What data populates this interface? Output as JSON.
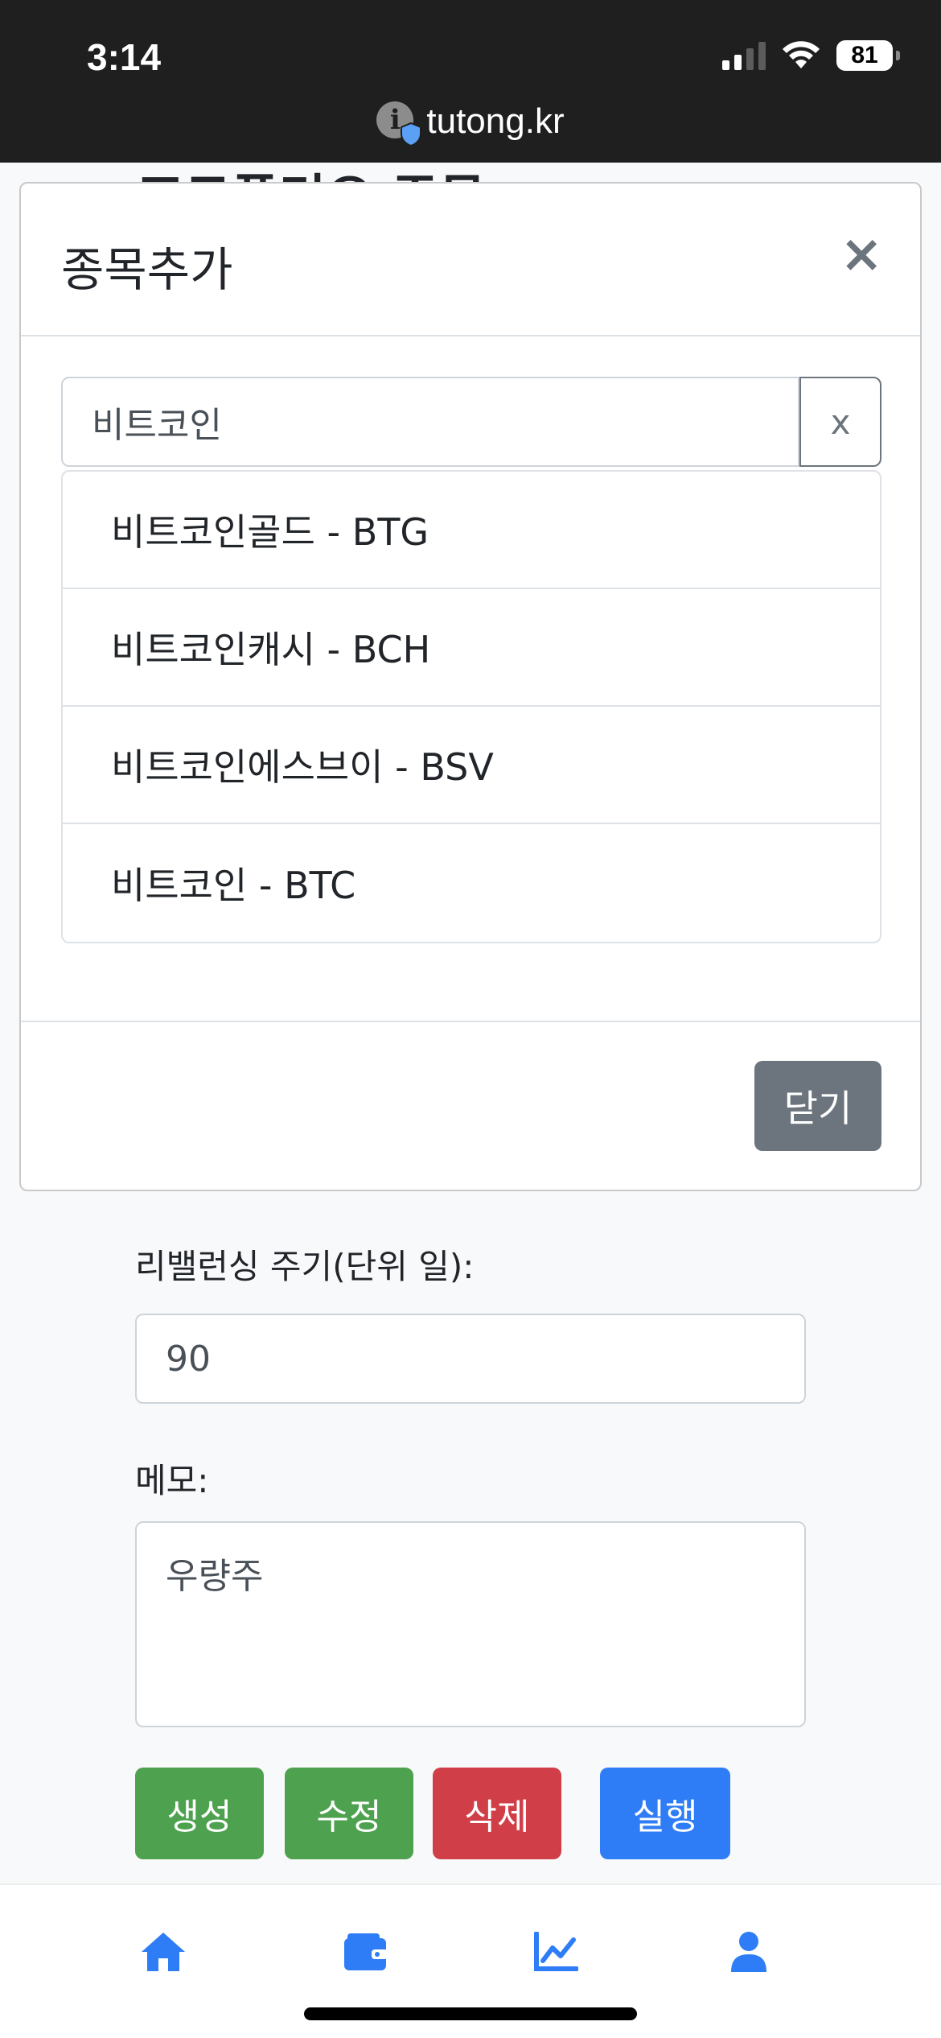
{
  "status_bar": {
    "time": "3:14",
    "battery": "81",
    "url": "tutong.kr",
    "icons": [
      "signal-icon",
      "wifi-icon",
      "battery-icon",
      "info-shield-icon"
    ]
  },
  "background_page": {
    "title": "포트폴리오 주문",
    "rebalance_label": "리밸런싱 주기(단위 일):",
    "rebalance_value": "90",
    "memo_label": "메모:",
    "memo_value": "우량주",
    "buttons": {
      "create": "생성",
      "edit": "수정",
      "delete": "삭제",
      "run": "실행"
    }
  },
  "modal": {
    "title": "종목추가",
    "close_symbol": "×",
    "search_value": "비트코인",
    "clear_label": "x",
    "results": [
      "비트코인골드 - BTG",
      "비트코인캐시 - BCH",
      "비트코인에스브이 - BSV",
      "비트코인 - BTC"
    ],
    "close_button": "닫기"
  },
  "bottom_nav": {
    "items": [
      "home-icon",
      "wallet-icon",
      "chart-line-icon",
      "user-icon"
    ],
    "accent": "#2f7df6"
  },
  "colors": {
    "green": "#4ea24f",
    "red": "#d03f48",
    "blue": "#2f7df6",
    "secondary": "#6c757d"
  }
}
